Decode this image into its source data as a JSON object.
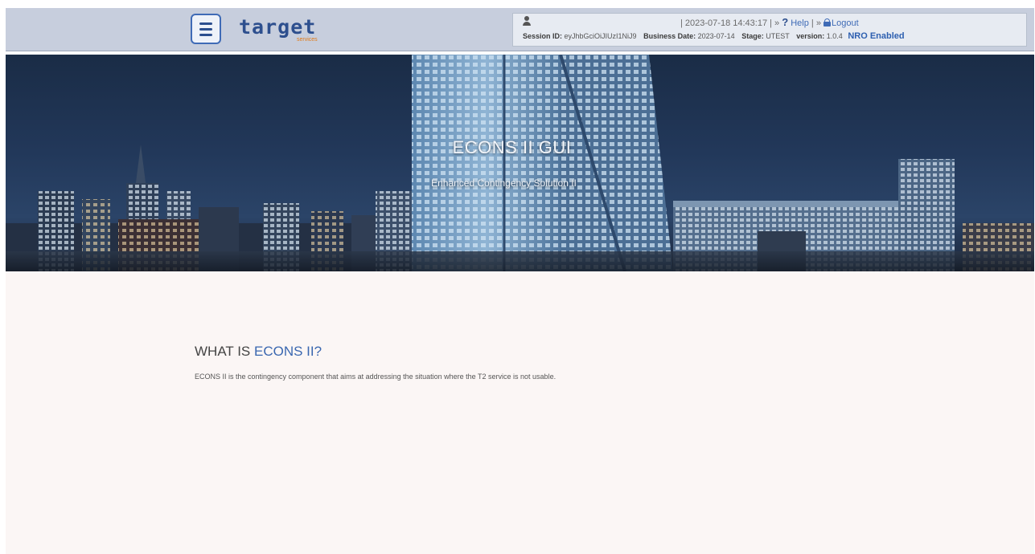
{
  "header": {
    "logo_text": "target",
    "logo_subtext": "services",
    "timestamp": "| 2023-07-18 14:43:17 |",
    "help_prefix": " » ",
    "help_icon": "?",
    "help_label": " Help ",
    "logout_prefix": "| » ",
    "logout_label": "Logout",
    "session_label": "Session ID:",
    "session_value": "eyJhbGciOiJIUzI1NiJ9",
    "business_date_label": "Business Date:",
    "business_date_value": "2023-07-14",
    "stage_label": "Stage:",
    "stage_value": "UTEST",
    "version_label": "version:",
    "version_value": "1.0.4",
    "nro_status": "NRO Enabled"
  },
  "icons": {
    "menu": "hamburger-menu-icon",
    "user": "user-icon",
    "help": "question-mark-icon",
    "logout": "lock-icon"
  },
  "hero": {
    "title": "ECONS II GUI",
    "subtitle": "Enhanced Contingency Solution II"
  },
  "main": {
    "heading_prefix": "WHAT IS ",
    "heading_accent": "ECONS II?",
    "description": "ECONS II is the contingency component that aims at addressing the situation where the T2 service is not usable."
  },
  "colors": {
    "header_bg": "#c7cedd",
    "accent_blue": "#3a67b0",
    "logo_orange": "#e07a18",
    "content_bg": "#fbf6f5"
  }
}
